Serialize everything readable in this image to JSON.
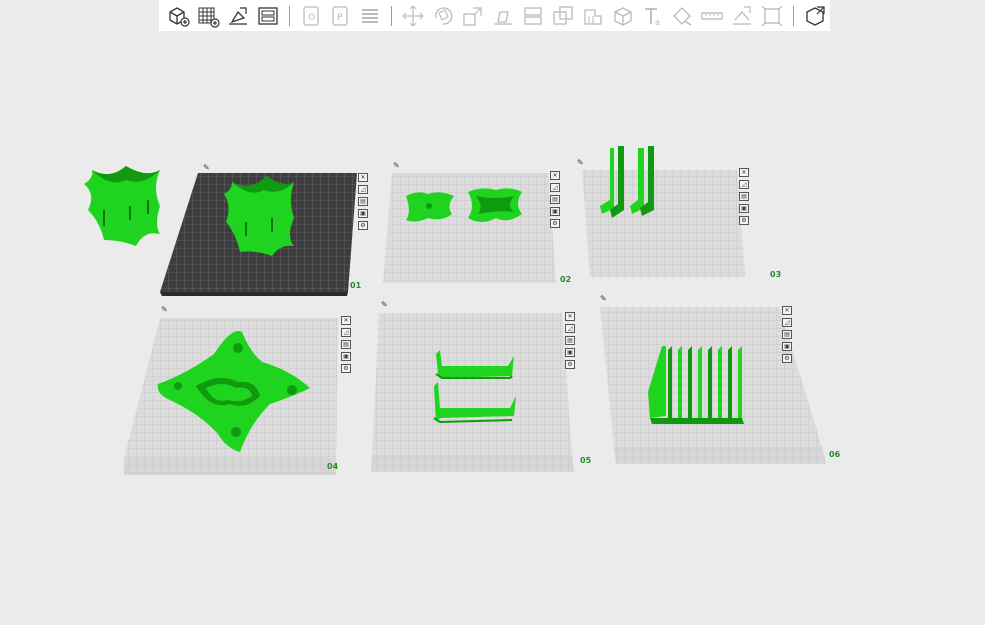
{
  "toolbar": {
    "groups": [
      [
        "add-part-icon",
        "add-plate-icon",
        "auto-orient-icon",
        "arrange-icon"
      ],
      [
        "split-objects-icon",
        "split-parts-icon",
        "layers-icon"
      ],
      [
        "move-icon",
        "rotate-icon",
        "scale-icon",
        "lay-on-face-icon",
        "cut-icon",
        "boolean-icon",
        "support-paint-icon",
        "seam-paint-icon",
        "text-icon",
        "color-paint-icon",
        "measure-icon",
        "assembly-icon",
        "mesh-boolean-icon"
      ],
      [
        "variable-layer-icon"
      ]
    ]
  },
  "plates": [
    {
      "id": "plate-1",
      "number": "01"
    },
    {
      "id": "plate-2",
      "number": "02"
    },
    {
      "id": "plate-3",
      "number": "03"
    },
    {
      "id": "plate-4",
      "number": "04"
    },
    {
      "id": "plate-5",
      "number": "05"
    },
    {
      "id": "plate-6",
      "number": "06"
    }
  ],
  "plate_tool_icons": [
    "close-plate-icon",
    "orient-plate-icon",
    "arrange-plate-icon",
    "lock-plate-icon",
    "plate-settings-icon"
  ],
  "colors": {
    "model_green": "#1ed41e",
    "model_green_dark": "#0f9a0f",
    "plate_light": "#dcdcdc",
    "plate_dark": "#3c3c3c",
    "background": "#ebebeb"
  }
}
